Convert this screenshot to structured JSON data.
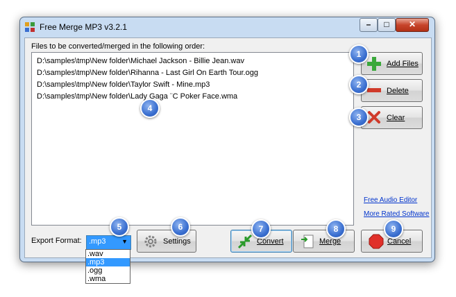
{
  "window": {
    "title": "Free Merge MP3 v3.2.1"
  },
  "titlebar_controls": {
    "minimize": "–",
    "maximize": "□",
    "close": "✕"
  },
  "list": {
    "label": "Files to be converted/merged in the following order:",
    "files": [
      "D:\\samples\\tmp\\New folder\\Michael Jackson - Billie Jean.wav",
      "D:\\samples\\tmp\\New folder\\Rihanna - Last Girl On Earth Tour.ogg",
      "D:\\samples\\tmp\\New folder\\Taylor Swift - Mine.mp3",
      "D:\\samples\\tmp\\New folder\\Lady Gaga ¨C Poker Face.wma"
    ]
  },
  "buttons": {
    "add_files": "Add Files",
    "delete": "Delete",
    "clear": "Clear",
    "settings": "Settings",
    "convert": "Convert",
    "merge": "Merge",
    "cancel": "Cancel"
  },
  "links": {
    "free_audio_editor": "Free Audio Editor",
    "more_rated_software": "More Rated Software"
  },
  "export": {
    "label": "Export Format:",
    "selected": ".mp3",
    "options": [
      ".wav",
      ".mp3",
      ".ogg",
      ".wma"
    ],
    "arrow": "▼"
  },
  "badges": [
    "1",
    "2",
    "3",
    "4",
    "5",
    "6",
    "7",
    "8",
    "9"
  ],
  "colors": {
    "badge": "#3a6fd0",
    "accent_selection": "#3399ff",
    "link": "#0033cc"
  }
}
